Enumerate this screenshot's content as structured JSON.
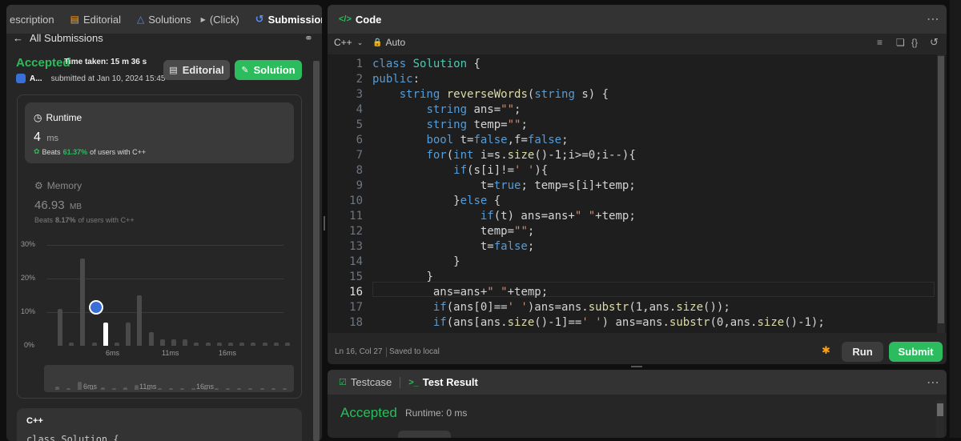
{
  "left": {
    "tabs": [
      {
        "label": "escription"
      },
      {
        "label": "Editorial"
      },
      {
        "label": "Solutions"
      },
      {
        "label": "(Click)"
      },
      {
        "label": "Submissions"
      }
    ],
    "back_label": "All Submissions",
    "status": "Accepted",
    "time_taken": "Time taken: 15 m 36 s",
    "user": "A...",
    "submitted_at": "submitted at Jan 10, 2024 15:45",
    "editorial_btn": "Editorial",
    "solution_btn": "Solution",
    "runtime": {
      "title": "Runtime",
      "value": "4",
      "unit": "ms",
      "beats_label": "Beats",
      "beats_value": "61.37%",
      "beats_suffix": "of users with C++"
    },
    "memory": {
      "title": "Memory",
      "value": "46.93",
      "unit": "MB",
      "beats_label": "Beats",
      "beats_value": "8.17%",
      "beats_suffix": "of users with C++"
    },
    "lang_card_title": "C++",
    "lang_card_snippet": "class Solution {"
  },
  "chart_data": {
    "type": "bar",
    "y_ticks": [
      "30%",
      "20%",
      "10%",
      "0%"
    ],
    "ylim": [
      0,
      30
    ],
    "x_ticks": [
      "6ms",
      "11ms",
      "16ms"
    ],
    "values": [
      11,
      1,
      26,
      1,
      7,
      1,
      7,
      15,
      4,
      2,
      2,
      2,
      1,
      1,
      1,
      1,
      1,
      1,
      1,
      1,
      1
    ],
    "highlight_index": 4,
    "mini_x_ticks": [
      "6ms",
      "11ms",
      "16ms"
    ]
  },
  "code": {
    "title": "Code",
    "language": "C++",
    "mode": "Auto",
    "status_pos": "Ln 16, Col 27",
    "status_saved": "Saved to local",
    "run_btn": "Run",
    "submit_btn": "Submit",
    "line_numbers": [
      "1",
      "2",
      "3",
      "4",
      "5",
      "6",
      "7",
      "8",
      "9",
      "10",
      "11",
      "12",
      "13",
      "14",
      "15",
      "16",
      "17",
      "18"
    ]
  },
  "bottom": {
    "tab_testcase": "Testcase",
    "tab_result": "Test Result",
    "status": "Accepted",
    "runtime": "Runtime: 0 ms"
  },
  "colors": {
    "accent_green": "#2cbb5d",
    "beats_green": "#2cbb5d",
    "panel_bg": "#262626",
    "tabbar_bg": "#333333"
  }
}
